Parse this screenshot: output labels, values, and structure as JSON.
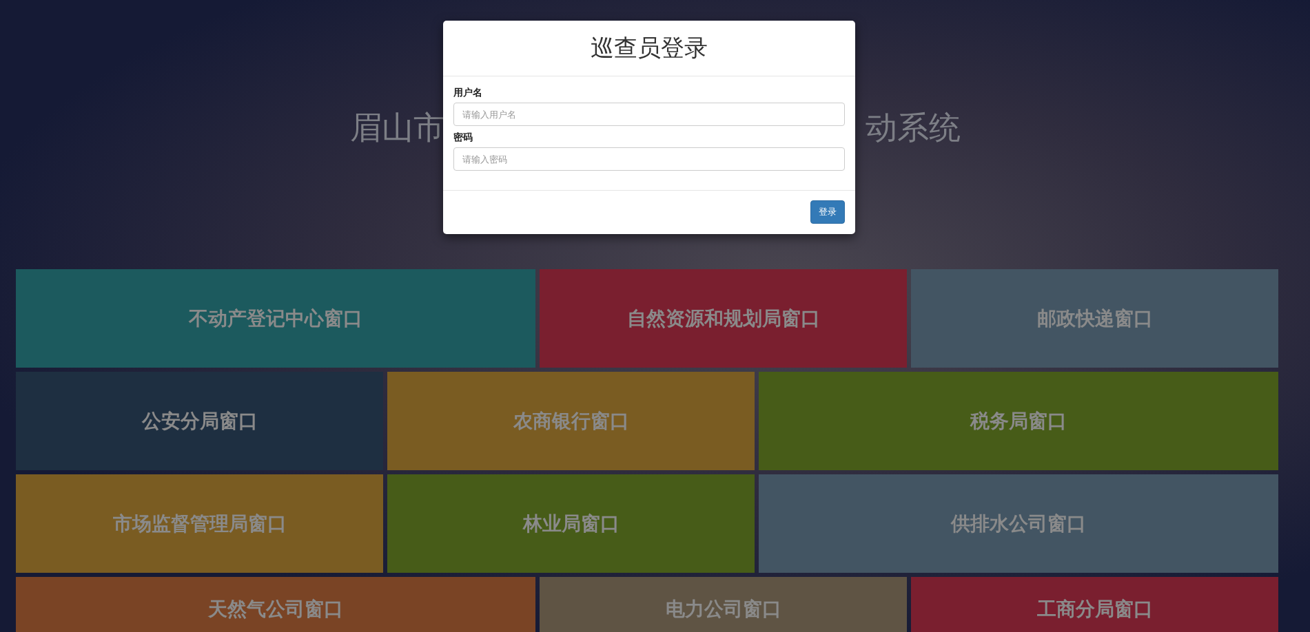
{
  "page_title": {
    "left": "眉山市",
    "right": "动系统"
  },
  "tile_rows": [
    [
      {
        "label": "不动产登记中心窗口",
        "color": "#1c5a5e",
        "kind": "wide"
      },
      {
        "label": "自然资源和规划局窗口",
        "color": "#7a1f2f",
        "kind": "medium"
      },
      {
        "label": "邮政快递窗口",
        "color": "#435563",
        "kind": "medium"
      }
    ],
    [
      {
        "label": "公安分局窗口",
        "color": "#1e2f41",
        "kind": "medium"
      },
      {
        "label": "农商银行窗口",
        "color": "#7a5c22",
        "kind": "medium"
      },
      {
        "label": "税务局窗口",
        "color": "#475c18",
        "kind": "wide"
      }
    ],
    [
      {
        "label": "市场监督管理局窗口",
        "color": "#7a5c22",
        "kind": "medium"
      },
      {
        "label": "林业局窗口",
        "color": "#475c18",
        "kind": "medium"
      },
      {
        "label": "供排水公司窗口",
        "color": "#435563",
        "kind": "wide"
      }
    ],
    [
      {
        "label": "天然气公司窗口",
        "color": "#7a4425",
        "kind": "wide"
      },
      {
        "label": "电力公司窗口",
        "color": "#5f5444",
        "kind": "medium"
      },
      {
        "label": "工商分局窗口",
        "color": "#7a1f2f",
        "kind": "medium"
      }
    ]
  ],
  "login_dialog": {
    "title": "巡查员登录",
    "fields": [
      {
        "label": "用户名",
        "placeholder": "请输入用户名"
      },
      {
        "label": "密码",
        "placeholder": "请输入密码"
      }
    ],
    "submit": "登录"
  }
}
